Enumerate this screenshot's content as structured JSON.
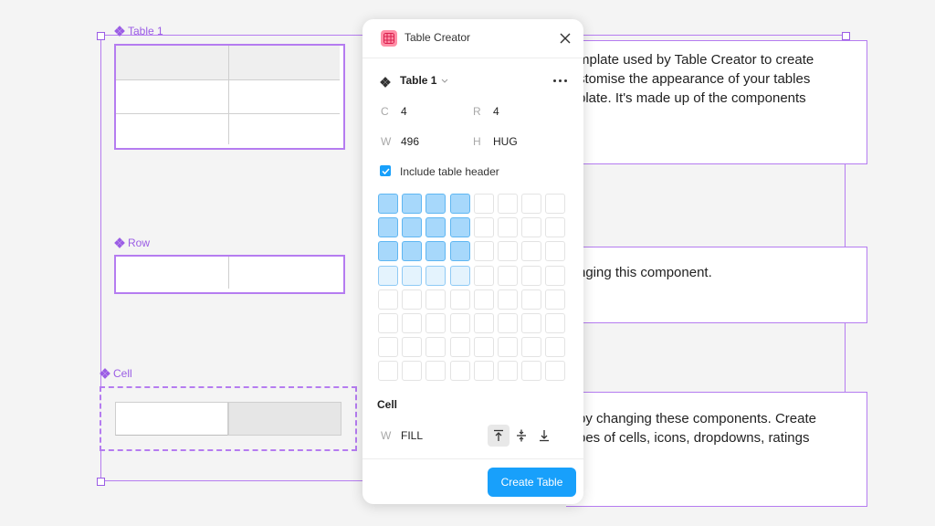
{
  "canvas": {
    "frames": {
      "table_label": "Table 1",
      "row_label": "Row",
      "cell_label": "Cell"
    },
    "text_blocks": [
      "mplate used by Table Creator to create\nstomise the appearance of your tables\nplate. It's made up of the components",
      "nging this component.",
      "by changing these components. Create\npes of cells, icons, dropdowns, ratings"
    ],
    "accent_color": "#9b5de5"
  },
  "panel": {
    "title": "Table Creator",
    "close_icon": "close-icon",
    "table_select": "Table 1",
    "columns_label": "C",
    "columns_value": "4",
    "rows_label": "R",
    "rows_value": "4",
    "width_label": "W",
    "width_value": "496",
    "height_label": "H",
    "height_value": "HUG",
    "include_header_label": "Include table header",
    "include_header_checked": true,
    "grid": {
      "columns": 8,
      "rows": 8,
      "selected_columns": 4,
      "selected_rows": 4,
      "header_row": true
    },
    "cell_section_title": "Cell",
    "cell_width_label": "W",
    "cell_width_value": "FILL",
    "create_button": "Create Table",
    "primary_color": "#18a0fb"
  }
}
